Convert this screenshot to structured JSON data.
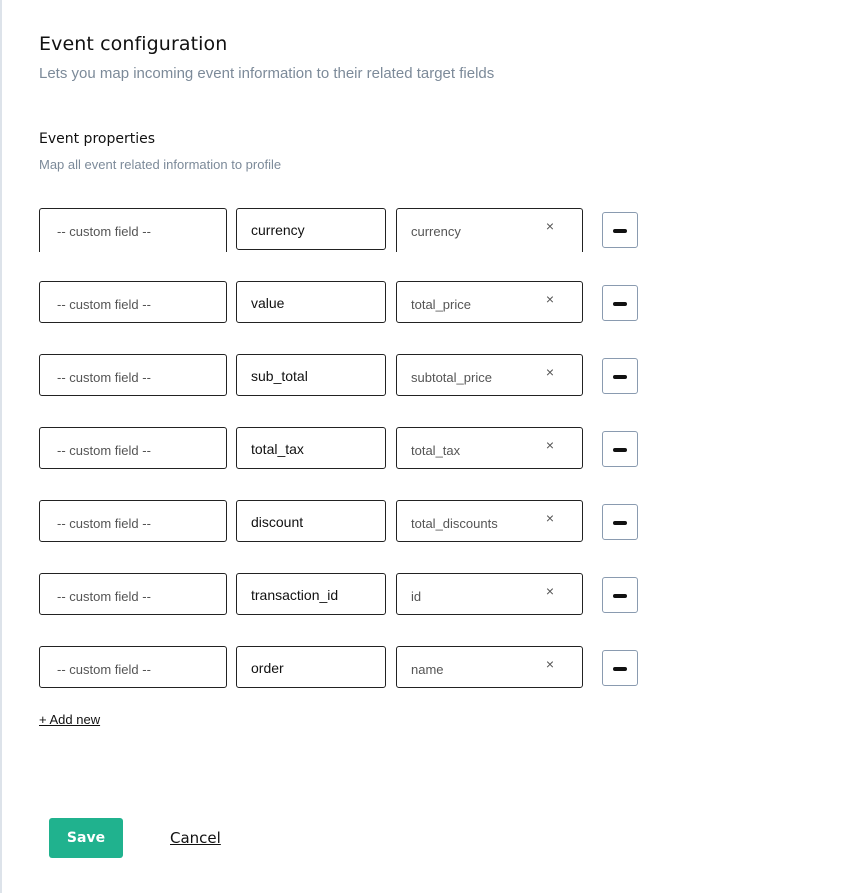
{
  "header": {
    "title": "Event configuration",
    "subtitle": "Lets you map incoming event information to their related target fields"
  },
  "section": {
    "title": "Event properties",
    "subtitle": "Map all event related information to profile"
  },
  "rows": [
    {
      "custom": "-- custom field --",
      "name": "currency",
      "target": "currency",
      "clear_icon": "×"
    },
    {
      "custom": "-- custom field --",
      "name": "value",
      "target": "total_price",
      "clear_icon": "×"
    },
    {
      "custom": "-- custom field --",
      "name": "sub_total",
      "target": "subtotal_price",
      "clear_icon": "×"
    },
    {
      "custom": "-- custom field --",
      "name": "total_tax",
      "target": "total_tax",
      "clear_icon": "×"
    },
    {
      "custom": "-- custom field --",
      "name": "discount",
      "target": "total_discounts",
      "clear_icon": "×"
    },
    {
      "custom": "-- custom field --",
      "name": "transaction_id",
      "target": "id",
      "clear_icon": "×"
    },
    {
      "custom": "-- custom field --",
      "name": "order",
      "target": "name",
      "clear_icon": "×"
    }
  ],
  "actions": {
    "add_new": "+ Add new",
    "save": "Save",
    "cancel": "Cancel"
  },
  "colors": {
    "accent": "#20b28e",
    "muted_text": "#7c8a99"
  }
}
